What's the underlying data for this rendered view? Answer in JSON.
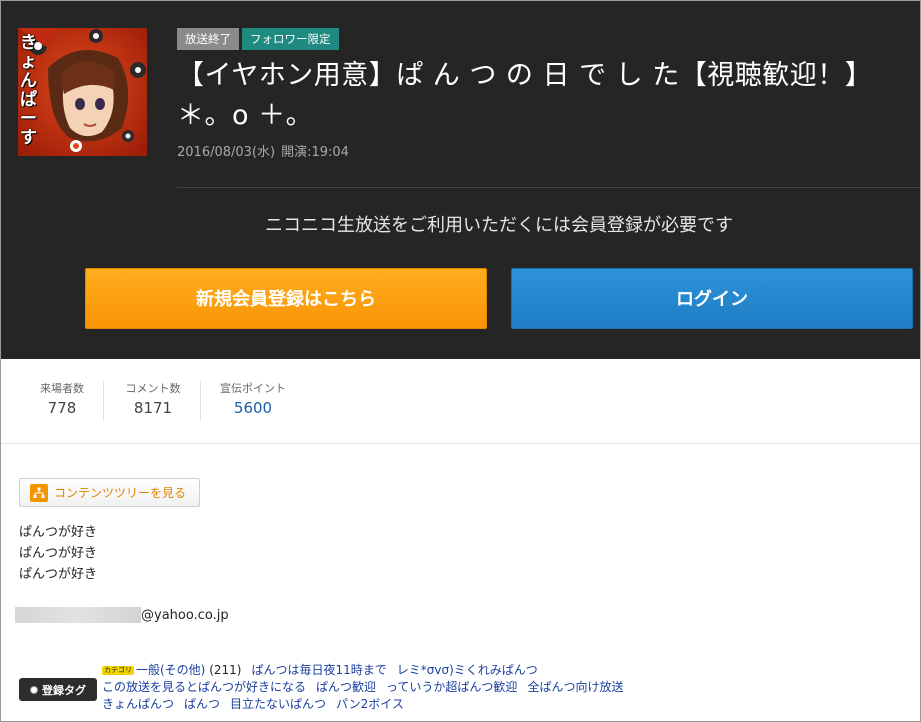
{
  "broadcast": {
    "status_badge": "放送終了",
    "follower_badge": "フォロワー限定",
    "title": "【イヤホン用意】ぱ ん つ の 日 で し た【視聴歓迎！】＊。o ＋。",
    "date": "2016/08/03(水)",
    "open_time": "開演:19:04"
  },
  "signup": {
    "message": "ニコニコ生放送をご利用いただくには会員登録が必要です",
    "register_label": "新規会員登録はこちら",
    "login_label": "ログイン"
  },
  "stats": [
    {
      "label": "来場者数",
      "value": "778"
    },
    {
      "label": "コメント数",
      "value": "8171"
    },
    {
      "label": "宣伝ポイント",
      "value": "5600"
    }
  ],
  "content": {
    "tree_button_label": "コンテンツツリーを見る",
    "description_lines": [
      "ぱんつが好き",
      "ぱんつが好き",
      "ぱんつが好き"
    ],
    "email_domain": "@yahoo.co.jp"
  },
  "tags": {
    "badge_label": "登録タグ",
    "category_chip": "カテゴリ",
    "category": {
      "name": "一般(その他)",
      "count": "(211)"
    },
    "rows": [
      [
        "ぱんつは毎日夜11時まで",
        "レミ*σvσ)ミくれみぱんつ"
      ],
      [
        "この放送を見るとぱんつが好きになる",
        "ぱんつ歓迎",
        "っていうか超ぱんつ歓迎",
        "全ぱんつ向け放送"
      ],
      [
        "きょんぱんつ",
        "ぱんつ",
        "目立たないぱんつ",
        "パン2ボイス"
      ]
    ]
  },
  "thumbnail": {
    "text": "きょんぱーす"
  },
  "colors": {
    "header_bg": "#252525",
    "register": "#f99404",
    "login": "#1e7dc4",
    "follower_badge": "#1f8a80",
    "tag_link": "#1a3fa0"
  }
}
